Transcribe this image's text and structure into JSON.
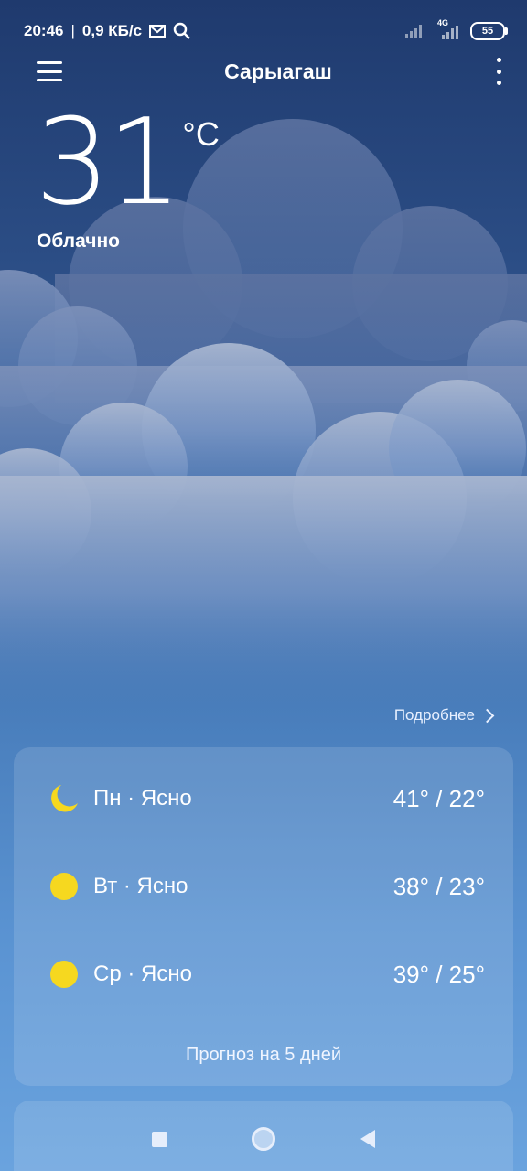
{
  "status_bar": {
    "time": "20:46",
    "speed": "0,9 КБ/с",
    "network_label": "4G",
    "battery": "55",
    "icons": [
      "mail-icon",
      "search-icon",
      "signal-icon",
      "signal-4g-icon",
      "battery-icon"
    ]
  },
  "header": {
    "city": "Сарыагаш"
  },
  "current": {
    "temperature": "31",
    "unit": "°C",
    "condition": "Облачно"
  },
  "details_link": "Подробнее",
  "forecast": {
    "days": [
      {
        "label": "Пн · Ясно",
        "temps": "41° / 22°",
        "icon": "moon-icon"
      },
      {
        "label": "Вт · Ясно",
        "temps": "38° / 23°",
        "icon": "sun-icon"
      },
      {
        "label": "Ср · Ясно",
        "temps": "39° / 25°",
        "icon": "sun-icon"
      }
    ],
    "footer": "Прогноз на 5 дней"
  },
  "colors": {
    "sun": "#f6d81f",
    "background_top": "#1f3a6e",
    "background_bottom": "#6aa3de"
  }
}
